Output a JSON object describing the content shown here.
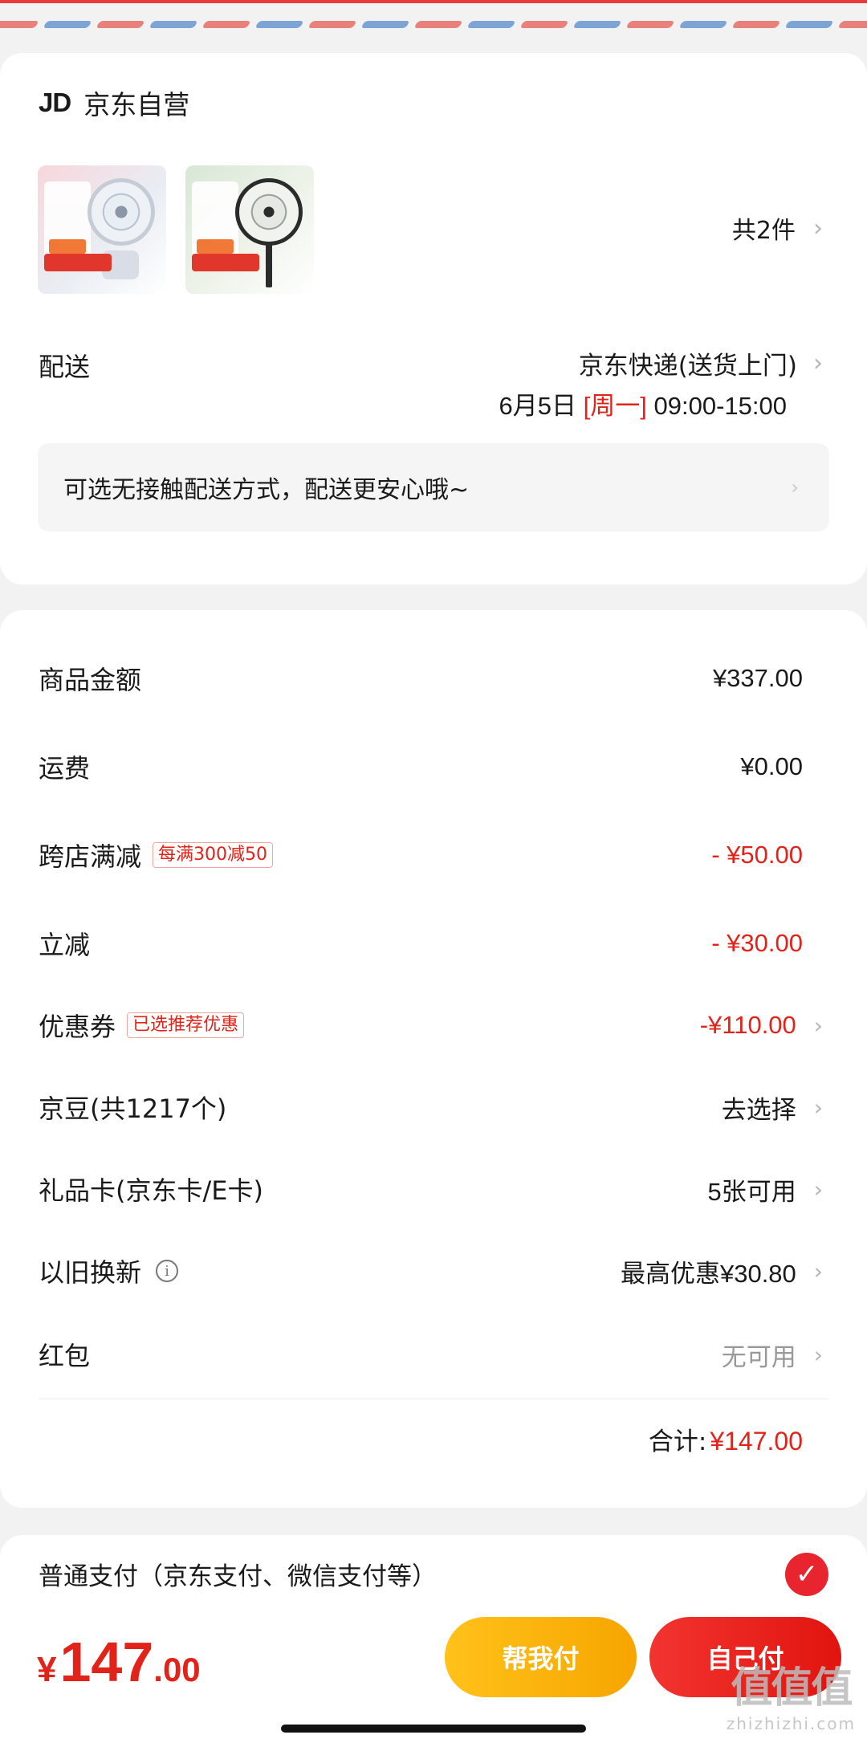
{
  "shop": {
    "logo": "JD",
    "name": "京东自营",
    "item_count": "共2件"
  },
  "delivery": {
    "label": "配送",
    "method": "京东快递(送货上门)",
    "date": "6月5日",
    "weekday": "[周一]",
    "time_window": "09:00-15:00",
    "contactless_text": "可选无接触配送方式，配送更安心哦~"
  },
  "amounts": {
    "subtotal": {
      "label": "商品金额",
      "value": "¥337.00"
    },
    "shipping": {
      "label": "运费",
      "value": "¥0.00"
    },
    "cross_store": {
      "label": "跨店满减",
      "badge": "每满300减50",
      "value": "- ¥50.00"
    },
    "instant_discount": {
      "label": "立减",
      "value": "- ¥30.00"
    },
    "coupon": {
      "label": "优惠券",
      "badge": "已选推荐优惠",
      "value": "-¥110.00"
    },
    "jd_beans": {
      "label": "京豆(共1217个)",
      "value": "去选择"
    },
    "gift_card": {
      "label": "礼品卡(京东卡/E卡)",
      "value": "5张可用"
    },
    "trade_in": {
      "label": "以旧换新",
      "value": "最高优惠¥30.80"
    },
    "red_packet": {
      "label": "红包",
      "value": "无可用"
    },
    "total_label": "合计:",
    "total_value": "¥147.00"
  },
  "payment": {
    "method_label": "普通支付（京东支付、微信支付等）"
  },
  "bottom_bar": {
    "currency": "¥",
    "price_int": "147",
    "price_dec": ".00",
    "help_pay_label": "帮我付",
    "self_pay_label": "自己付"
  },
  "watermark": {
    "mark": "值值值",
    "url": "zhizhizhi.com"
  },
  "icons": {
    "chevron": "chevron-right-icon",
    "info": "info-icon",
    "check": "check-icon"
  },
  "colors": {
    "accent_red": "#e2231a",
    "help_button": "#f7a500",
    "self_button": "#e1140f"
  }
}
